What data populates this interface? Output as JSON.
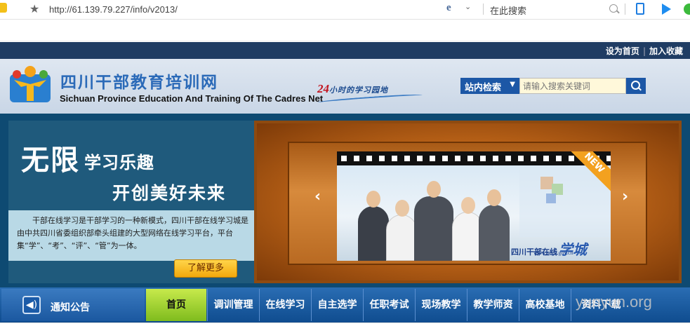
{
  "browser": {
    "url": "http://61.139.79.227/info/v2013/",
    "search_placeholder": "在此搜索"
  },
  "top_links": {
    "set_home": "设为首页",
    "separator": "|",
    "bookmark": "加入收藏"
  },
  "header": {
    "title": "四川干部教育培训网",
    "subtitle": "Sichuan Province Education And Training Of The Cadres Net",
    "slogan_num": "24",
    "slogan_text": "小时的学习园地"
  },
  "site_search": {
    "scope_label": "站内检索",
    "placeholder": "请输入搜索关键词"
  },
  "banner": {
    "headline_big": "无限",
    "headline_rest": "学习乐趣",
    "headline2": "开创美好未来",
    "intro": "干部在线学习是干部学习的一种新模式，四川干部在线学习城是由中共四川省委组织部牵头组建的大型网络在线学习平台，平台集“学”、“考”、“评”、“管”为一体。",
    "more_label": "了解更多",
    "prev": "‹",
    "next": "›",
    "photo_caption": "四川干部在线",
    "photo_caption_big": "学城",
    "photo_url": "www.scgb.gov.cn",
    "badge": "NEW"
  },
  "nav": {
    "notice": "通知公告",
    "home": "首页",
    "items": [
      "调训管理",
      "在线学习",
      "自主选学",
      "任职考试",
      "现场教学",
      "教学师资",
      "高校基地",
      "资料下载"
    ]
  },
  "watermark": "yunyun.org",
  "colors": {
    "brand_blue": "#1c57a6",
    "nav_green": "#8cc628",
    "top_strip": "#1f3c63"
  }
}
